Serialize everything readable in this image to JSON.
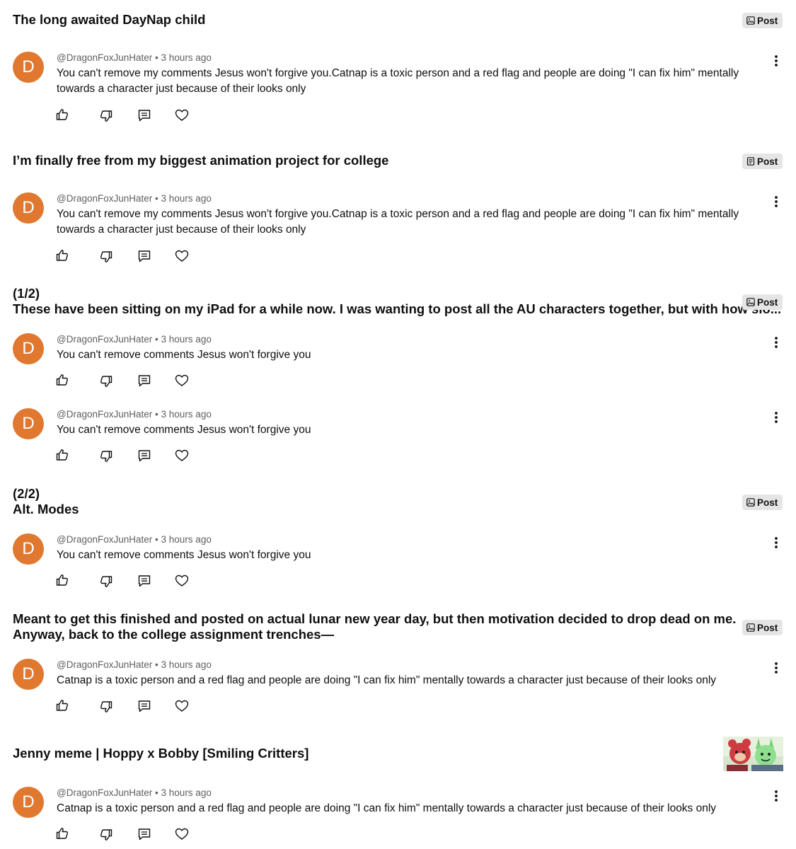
{
  "tag_label": "Post",
  "avatar_letter": "D",
  "comment_author": "@DragonFoxJunHater",
  "comment_separator": "•",
  "comment_time": "3 hours ago",
  "sections": [
    {
      "title_lines": [
        "The long awaited DayNap child"
      ],
      "tag": "Post",
      "tag_icon": "image-icon"
    },
    {
      "title_lines": [
        "I’m finally free from my biggest animation project for college"
      ],
      "tag": "Post",
      "tag_icon": "document-icon"
    },
    {
      "title_lines": [
        "(1/2)",
        "These have been sitting on my iPad for a while now. I was wanting to post all the AU characters together, but with how slo..."
      ],
      "tag": "Post",
      "tag_icon": "image-icon"
    },
    {
      "title_lines": [
        "(2/2)",
        "Alt. Modes"
      ],
      "tag": "Post",
      "tag_icon": "image-icon"
    },
    {
      "title_lines": [
        "Meant to get this finished and posted on actual lunar new year day, but then motivation decided to drop dead on me.",
        "Anyway, back to the college assignment trenches—"
      ],
      "tag": "Post",
      "tag_icon": "image-icon"
    },
    {
      "title_lines": [
        "Jenny meme | Hoppy x Bobby [Smiling Critters]"
      ],
      "tag": null,
      "thumbnail": "smiling-critters-thumbnail"
    }
  ],
  "comments": [
    {
      "text_lines": [
        "You can't remove my comments Jesus won't forgive you.Catnap is a toxic person and a red flag and people are doing \"I can fix him\" mentally",
        "towards a character just because of their looks only"
      ]
    },
    {
      "text_lines": [
        "You can't remove my comments Jesus won't forgive you.Catnap is a toxic person and a red flag and people are doing \"I can fix him\" mentally",
        "towards a character just because of their looks only"
      ]
    },
    {
      "text_lines": [
        "You can't remove comments Jesus won't forgive you"
      ]
    },
    {
      "text_lines": [
        "You can't remove comments Jesus won't forgive you"
      ]
    },
    {
      "text_lines": [
        "You can't remove comments Jesus won't forgive you"
      ]
    },
    {
      "text_lines": [
        "Catnap is a toxic person and a red flag and people are doing \"I can fix him\" mentally towards a character just because of their looks only"
      ]
    },
    {
      "text_lines": [
        "Catnap is a toxic person and a red flag and people are doing \"I can fix him\" mentally towards a character just because of their looks only"
      ]
    }
  ],
  "icons": {
    "like": "thumbs-up-icon",
    "dislike": "thumbs-down-icon",
    "reply": "reply-icon",
    "heart": "heart-icon",
    "more": "more-vertical-icon"
  }
}
